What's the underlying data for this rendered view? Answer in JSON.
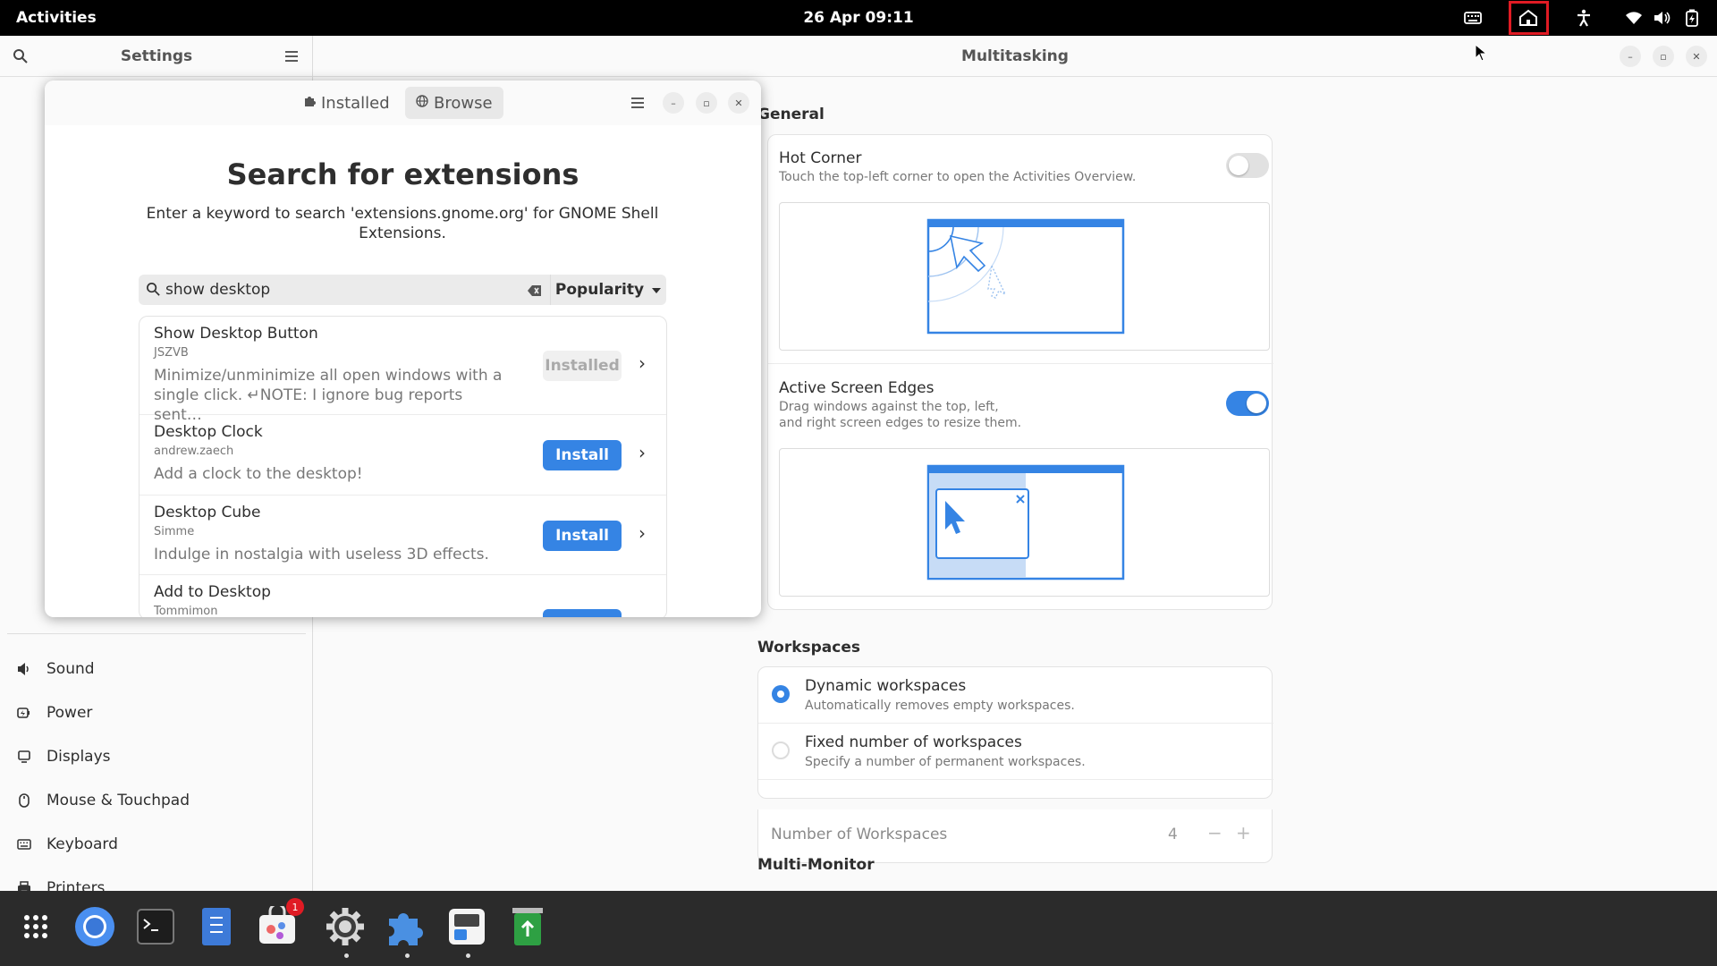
{
  "topbar": {
    "activities": "Activities",
    "clock": "26 Apr  09:11",
    "icons": [
      "keyboard-icon",
      "home-icon",
      "accessibility-icon",
      "wifi-icon",
      "volume-icon",
      "battery-icon"
    ]
  },
  "settings": {
    "sidebar_title": "Settings",
    "sidebar_items": [
      {
        "label": "Sound",
        "icon": "sound-icon"
      },
      {
        "label": "Power",
        "icon": "power-icon"
      },
      {
        "label": "Displays",
        "icon": "displays-icon"
      },
      {
        "label": "Mouse & Touchpad",
        "icon": "mouse-icon"
      },
      {
        "label": "Keyboard",
        "icon": "keyboard-icon"
      },
      {
        "label": "Printers",
        "icon": "printer-icon"
      }
    ],
    "page_title": "Multitasking",
    "general": {
      "title": "General",
      "hot_corner": {
        "title": "Hot Corner",
        "subtitle": "Touch the top-left corner to open the Activities Overview.",
        "enabled": false
      },
      "active_edges": {
        "title": "Active Screen Edges",
        "subtitle_line1": "Drag windows against the top, left,",
        "subtitle_line2": "and right screen edges to resize them.",
        "enabled": true
      }
    },
    "workspaces": {
      "title": "Workspaces",
      "dynamic": {
        "title": "Dynamic workspaces",
        "subtitle": "Automatically removes empty workspaces.",
        "selected": true
      },
      "fixed": {
        "title": "Fixed number of workspaces",
        "subtitle": "Specify a number of permanent workspaces.",
        "selected": false
      },
      "number_label": "Number of Workspaces",
      "number_value": "4",
      "minus": "−",
      "plus": "+"
    },
    "multi_monitor": {
      "title": "Multi-Monitor"
    }
  },
  "extensions": {
    "tabs": [
      {
        "label": "Installed",
        "icon": "puzzle-icon"
      },
      {
        "label": "Browse",
        "icon": "globe-icon"
      }
    ],
    "title": "Search for extensions",
    "description": "Enter a keyword to search 'extensions.gnome.org' for GNOME Shell Extensions.",
    "search_value": "show desktop",
    "sort_label": "Popularity",
    "results": [
      {
        "name": "Show Desktop Button",
        "author": "JSZVB",
        "desc": "Minimize/unminimize all open windows with a single click. ↵NOTE: I ignore bug reports sent…",
        "action": "Installed",
        "installed": true
      },
      {
        "name": "Desktop Clock",
        "author": "andrew.zaech",
        "desc": "Add a clock to the desktop!",
        "action": "Install",
        "installed": false
      },
      {
        "name": "Desktop Cube",
        "author": "Simme",
        "desc": "Indulge in nostalgia with useless 3D effects.",
        "action": "Install",
        "installed": false
      },
      {
        "name": "Add to Desktop",
        "author": "Tommimon",
        "desc": "",
        "action": "Install",
        "installed": false
      }
    ]
  },
  "dock": {
    "apps": [
      "app-grid-icon",
      "chromium-icon",
      "terminal-icon",
      "text-editor-icon",
      "software-icon",
      "settings-icon",
      "extension-manager-icon",
      "installer-icon",
      "trash-icon"
    ],
    "badge": "1"
  },
  "colors": {
    "accent": "#3584e4",
    "highlight": "#e01b24",
    "topbar": "#000000",
    "dock": "#2b2b2b"
  }
}
